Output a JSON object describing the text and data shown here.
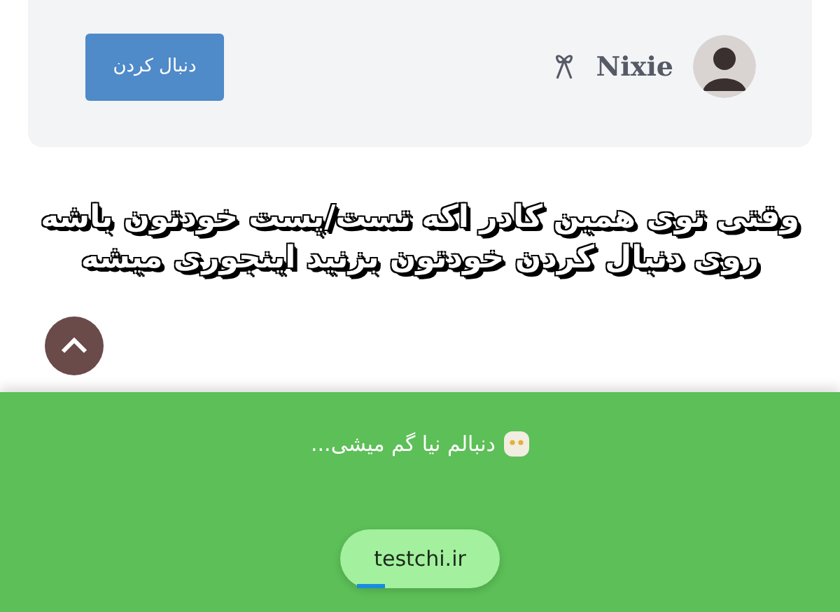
{
  "profile_card": {
    "name": "Nixie",
    "follow_button": "دنبال کردن"
  },
  "headline": [
    "وقتی توی همین کادر اکه تست/پست خودتون باشه",
    "روی دنبال کردن خودتون بزنید اینجوری میشه"
  ],
  "popup": {
    "message": "دنبالم نیا گم میشی...",
    "site_button": "testchi.ir",
    "progress": {
      "level": 0.2
    }
  }
}
